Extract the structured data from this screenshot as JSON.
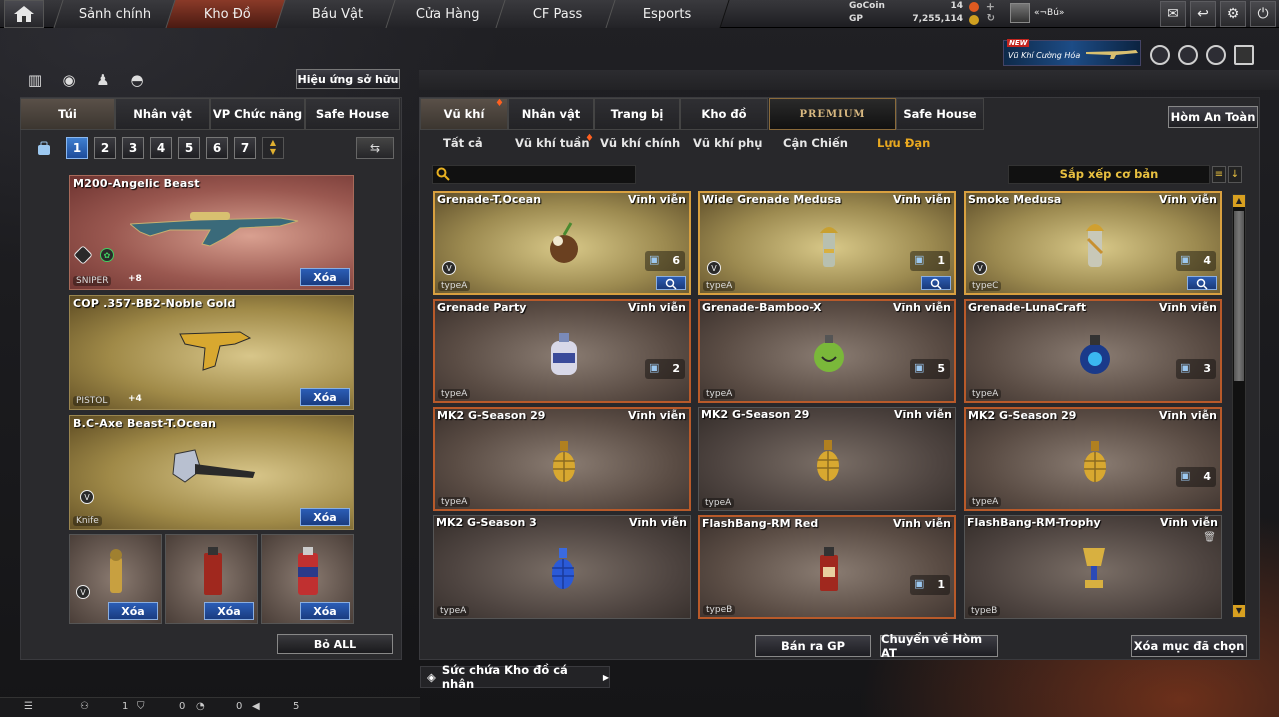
{
  "nav": {
    "tabs": [
      "Sảnh chính",
      "Kho Đồ",
      "Báu Vật",
      "Cửa Hàng",
      "CF Pass",
      "Esports"
    ],
    "active_tab": "Kho Đồ"
  },
  "currency": {
    "gocoin_label": "GoCoin",
    "gocoin_value": "14",
    "gp_label": "GP",
    "gp_value": "7,255,114",
    "plus": "+"
  },
  "player": {
    "name": "«¬Bú»"
  },
  "banner": {
    "new_label": "NEW",
    "text": "Vũ Khí Cường Hóa"
  },
  "left": {
    "effect_button": "Hiệu ứng sở hữu",
    "tabs": [
      "Túi",
      "Nhân vật",
      "VP Chức năng",
      "Safe House"
    ],
    "pages": [
      "1",
      "2",
      "3",
      "4",
      "5",
      "6",
      "7"
    ],
    "slots": [
      {
        "name": "M200-Angelic Beast",
        "type": "SNIPER",
        "plus": "+8",
        "delete": "Xóa"
      },
      {
        "name": "COP .357-BB2-Noble Gold",
        "type": "PISTOL",
        "plus": "+4",
        "delete": "Xóa"
      },
      {
        "name": "B.C-Axe Beast-T.Ocean",
        "type": "Knife",
        "delete": "Xóa"
      }
    ],
    "mini_slots": [
      {
        "delete": "Xóa"
      },
      {
        "delete": "Xóa"
      },
      {
        "delete": "Xóa"
      }
    ],
    "remove_all": "Bỏ ALL"
  },
  "right": {
    "tabs": [
      "Vũ khí",
      "Nhân vật",
      "Trang bị",
      "Kho đồ",
      "PREMIUM",
      "Safe House"
    ],
    "safe_box_button": "Hòm An Toàn",
    "subtabs": [
      "Tất cả",
      "Vũ khí tuần",
      "Vũ khí chính",
      "Vũ khí phụ",
      "Cận Chiến",
      "Lựu Đạn"
    ],
    "active_subtab": "Lựu Đạn",
    "search_placeholder": "",
    "sort_label": "Sắp xếp cơ bản",
    "items": [
      {
        "name": "Grenade-T.Ocean",
        "duration": "Vĩnh viễn",
        "type": "typeA",
        "count": "6",
        "style": "gold",
        "icon": "grenade-coconut-icon"
      },
      {
        "name": "Wide Grenade Medusa",
        "duration": "Vĩnh viễn",
        "type": "typeA",
        "count": "1",
        "style": "gold",
        "icon": "grenade-medusa-icon"
      },
      {
        "name": "Smoke Medusa",
        "duration": "Vĩnh viễn",
        "type": "typeC",
        "count": "4",
        "style": "gold",
        "icon": "smoke-medusa-icon"
      },
      {
        "name": "Grenade Party",
        "duration": "Vĩnh viễn",
        "type": "typeA",
        "count": "2",
        "style": "brown",
        "icon": "grenade-party-icon"
      },
      {
        "name": "Grenade-Bamboo-X",
        "duration": "Vĩnh viễn",
        "type": "typeA",
        "count": "5",
        "style": "brown",
        "icon": "grenade-bamboo-icon"
      },
      {
        "name": "Grenade-LunaCraft",
        "duration": "Vĩnh viễn",
        "type": "typeA",
        "count": "3",
        "style": "brown",
        "icon": "grenade-luna-icon"
      },
      {
        "name": "MK2 G-Season 29",
        "duration": "Vĩnh viễn",
        "type": "typeA",
        "count": "",
        "style": "brown",
        "icon": "grenade-mk2-gold-icon"
      },
      {
        "name": "MK2 G-Season 29",
        "duration": "Vĩnh viễn",
        "type": "typeA",
        "count": "",
        "style": "plain",
        "icon": "grenade-mk2-gold-icon"
      },
      {
        "name": "MK2 G-Season 29",
        "duration": "Vĩnh viễn",
        "type": "typeA",
        "count": "4",
        "style": "brown",
        "icon": "grenade-mk2-gold-icon"
      },
      {
        "name": "MK2 G-Season 3",
        "duration": "Vĩnh viễn",
        "type": "typeA",
        "count": "",
        "style": "plain",
        "icon": "grenade-mk2-blue-icon"
      },
      {
        "name": "FlashBang-RM Red",
        "duration": "Vĩnh viễn",
        "type": "typeB",
        "count": "1",
        "style": "brown",
        "icon": "flashbang-red-icon"
      },
      {
        "name": "FlashBang-RM-Trophy",
        "duration": "Vĩnh viễn",
        "type": "typeB",
        "count": "",
        "style": "plain",
        "icon": "flashbang-trophy-icon"
      }
    ],
    "sell_button": "Bán ra GP",
    "move_button": "Chuyển về Hòm AT",
    "delete_selected_button": "Xóa mục đã chọn",
    "capacity_label": "Sức chứa Kho đồ cá nhân"
  },
  "status": {
    "count1": "1",
    "count2": "0",
    "count3": "0",
    "volume": "5"
  }
}
